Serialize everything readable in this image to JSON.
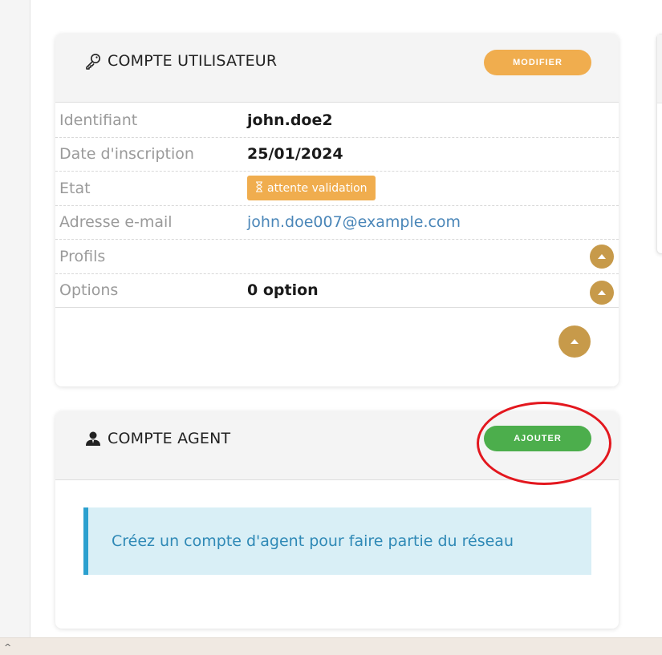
{
  "user_account": {
    "title": "COMPTE UTILISATEUR",
    "title_icon": "key-icon",
    "modify_label": "MODIFIER",
    "rows": [
      {
        "label": "Identifiant",
        "value": "john.doe2"
      },
      {
        "label": "Date d'inscription",
        "value": "25/01/2024"
      },
      {
        "label": "Etat",
        "value": "attente validation",
        "icon": "hourglass-icon"
      },
      {
        "label": "Adresse e-mail",
        "value": "john.doe007@example.com"
      },
      {
        "label": "Profils",
        "value": ""
      },
      {
        "label": "Options",
        "value": "0 option"
      }
    ]
  },
  "agent_account": {
    "title": "COMPTE AGENT",
    "title_icon": "user-icon",
    "add_label": "AJOUTER",
    "info_text": "Créez un compte d'agent pour faire partie du réseau"
  },
  "colors": {
    "modify_button": "#f0ad4e",
    "add_button": "#4cae4c",
    "expand_button": "#c79a4a",
    "info_border": "#2ba0cf",
    "annotation": "#e3171e"
  }
}
